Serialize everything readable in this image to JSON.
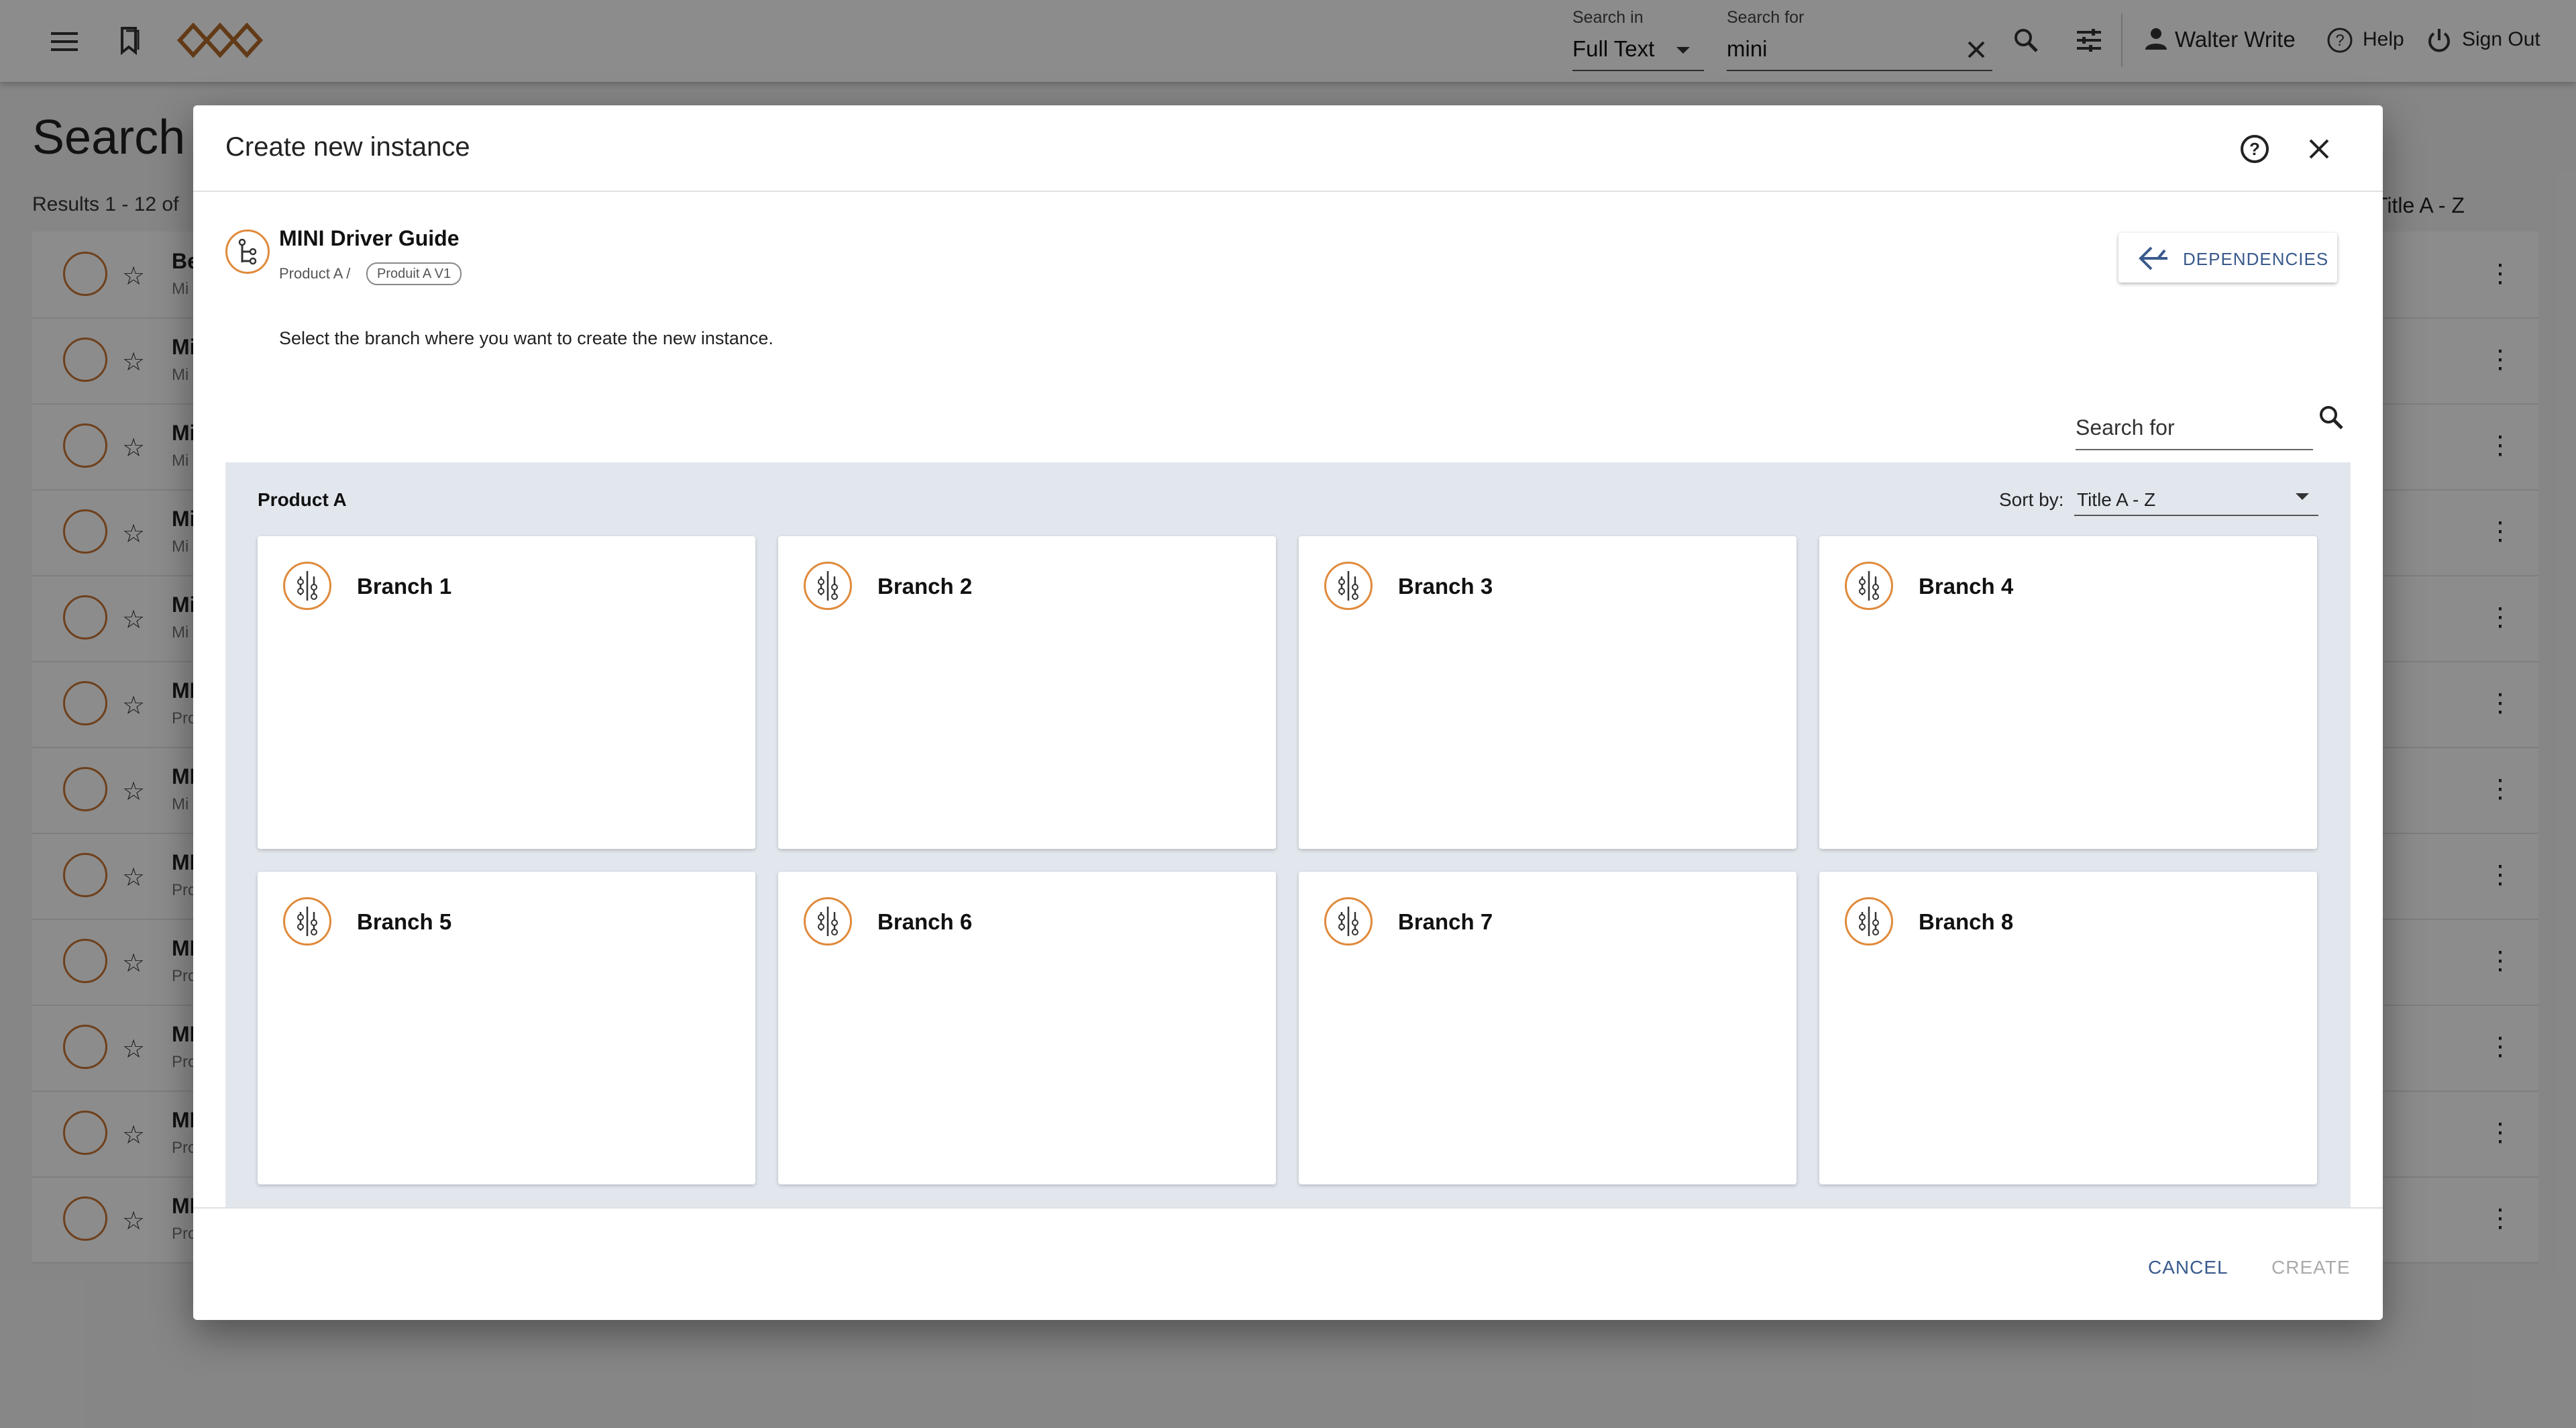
{
  "topbar": {
    "search_in_label": "Search in",
    "search_in_value": "Full Text",
    "search_for_label": "Search for",
    "search_for_value": "mini",
    "user_name": "Walter Write",
    "help_label": "Help",
    "signout_label": "Sign Out"
  },
  "page": {
    "title": "Search",
    "results_text": "Results 1 - 12 of",
    "sort_text": "Title A - Z",
    "rows": [
      {
        "title": "Be",
        "sub": "Mi"
      },
      {
        "title": "Mi",
        "sub": "Mi"
      },
      {
        "title": "Mi",
        "sub": "Mi"
      },
      {
        "title": "Mi",
        "sub": "Mi"
      },
      {
        "title": "Mi",
        "sub": "Mi"
      },
      {
        "title": "MI",
        "sub": "Pro"
      },
      {
        "title": "MI",
        "sub": "Mi"
      },
      {
        "title": "MI",
        "sub": "Pro"
      },
      {
        "title": "MI",
        "sub": "Pro"
      },
      {
        "title": "MI",
        "sub": "Pro"
      },
      {
        "title": "MI",
        "sub": "Pro"
      },
      {
        "title": "MI",
        "sub": "Pro"
      }
    ]
  },
  "dialog": {
    "title": "Create new instance",
    "doc_title": "MINI Driver Guide",
    "doc_path": "Product A /",
    "doc_version": "Produit A V1",
    "dependencies_label": "DEPENDENCIES",
    "instruction": "Select the branch where you want to create the new instance.",
    "search_label": "Search for",
    "panel_title": "Product A",
    "sort_by_label": "Sort by:",
    "sort_by_value": "Title A - Z",
    "branches": [
      "Branch 1",
      "Branch 2",
      "Branch 3",
      "Branch 4",
      "Branch 5",
      "Branch 6",
      "Branch 7",
      "Branch 8"
    ],
    "cancel_label": "CANCEL",
    "create_label": "CREATE"
  },
  "colors": {
    "accent_orange": "#e08a3c",
    "link_blue": "#3a5a8c",
    "panel_bg": "#e2e7ee"
  }
}
